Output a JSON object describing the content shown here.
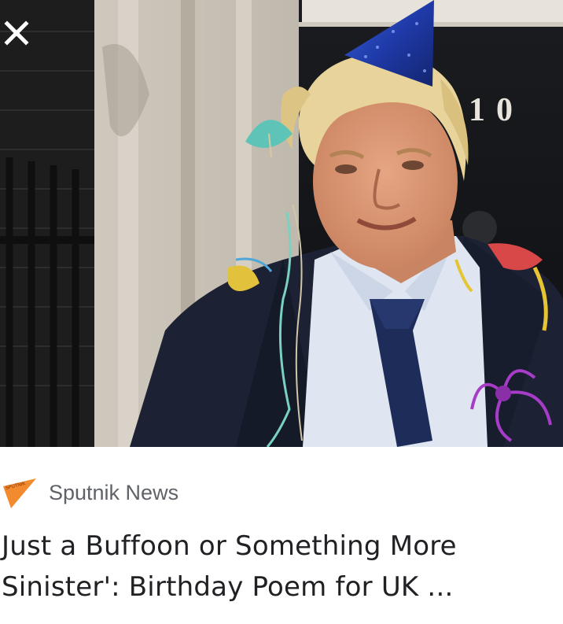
{
  "hero": {
    "image_alt": "Wax figure of a blonde man in a dark suit, blue tie and a blue party hat, covered in streamers, in front of a black door",
    "door_number": "10"
  },
  "controls": {
    "close_icon": "close-icon"
  },
  "article": {
    "source_logo_text": "SPUTNIK",
    "source_name": "Sputnik News",
    "headline": "Just a Buffoon or Something More Sinister': Birthday Poem for UK ..."
  },
  "colors": {
    "source_logo": "#f28b30",
    "source_text": "#5f6368",
    "headline_text": "#202124"
  }
}
